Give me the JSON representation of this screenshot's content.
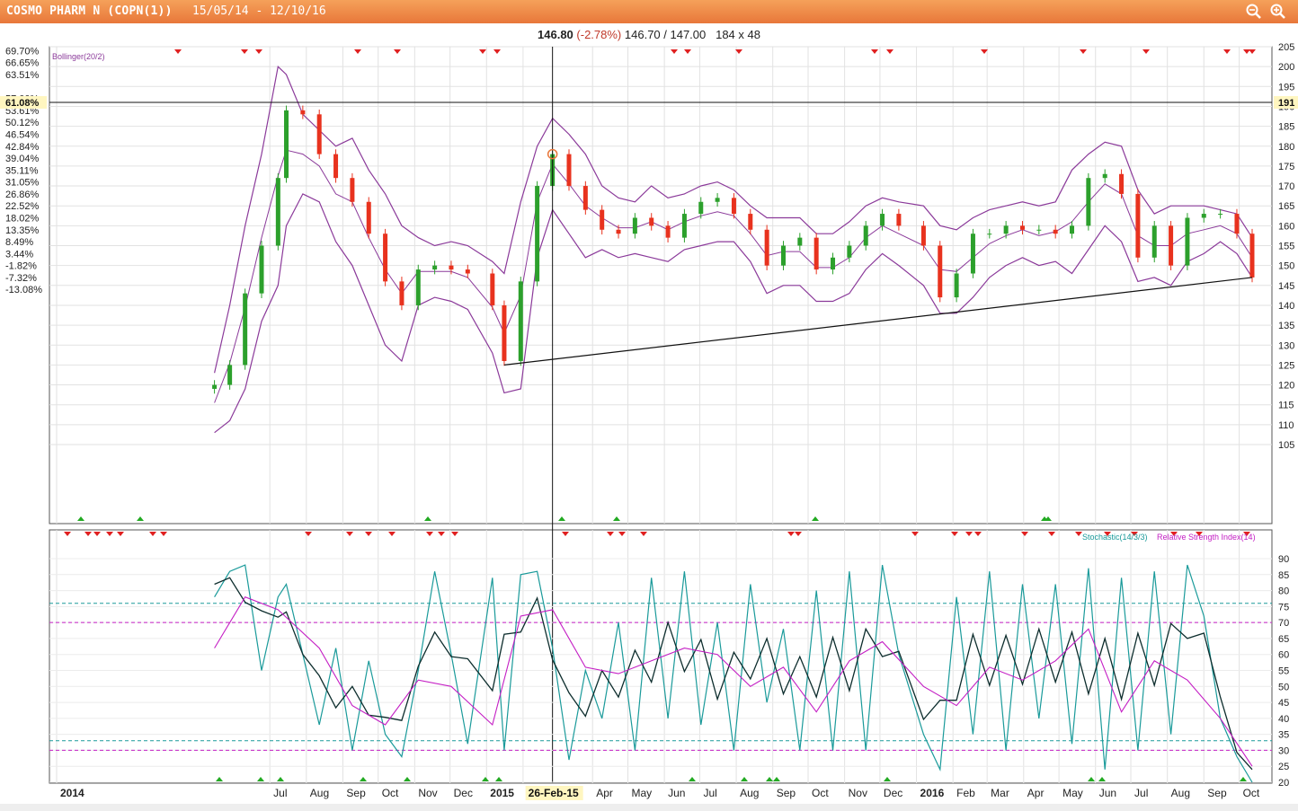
{
  "header": {
    "title": "COSMO PHARM N (COPN(1))",
    "date_range": "15/05/14 - 12/10/16",
    "zoom_in_icon": "zoom-in-icon",
    "zoom_out_icon": "zoom-out-icon"
  },
  "quote": {
    "last": "146.80",
    "change": "(-2.78%)",
    "bid_ask": "146.70 / 147.00",
    "size": "184 x 48"
  },
  "colors": {
    "title_bar": "#e8773a",
    "up_candle": "#2ca02c",
    "down_candle": "#e8321e",
    "bollinger": "#8b3a9a",
    "stochastic_k": "#1a9a9a",
    "stochastic_d": "#0d2d2d",
    "rsi": "#c41ec4",
    "sell_marker": "#e02020",
    "buy_marker": "#22aa22"
  },
  "chart_data": [
    {
      "type": "candlestick",
      "title": "",
      "legend": "Bollinger(20/2)",
      "y_right_ticks": [
        205,
        200,
        195,
        190,
        185,
        180,
        175,
        170,
        165,
        160,
        155,
        150,
        145,
        140,
        135,
        130,
        125,
        120,
        115,
        110,
        105
      ],
      "y_left_ticks": [
        "69.70%",
        "66.65%",
        "63.51%",
        "57.00%",
        "53.61%",
        "50.12%",
        "46.54%",
        "42.84%",
        "39.04%",
        "35.11%",
        "31.05%",
        "26.86%",
        "22.52%",
        "18.02%",
        "13.35%",
        "8.49%",
        "3.44%",
        "-1.82%",
        "-7.32%",
        "-13.08%"
      ],
      "crosshair": {
        "price": "191",
        "percent": "61.08%",
        "date": "26-Feb-15"
      },
      "trendline": {
        "from": [
          "2015-01-16",
          125
        ],
        "to": [
          "2016-10-12",
          147
        ]
      },
      "series": [
        {
          "name": "COPN(1)",
          "x": [
            "2014-05-15",
            "2014-05-28",
            "2014-06-10",
            "2014-06-24",
            "2014-07-08",
            "2014-07-15",
            "2014-07-29",
            "2014-08-12",
            "2014-08-26",
            "2014-09-09",
            "2014-09-23",
            "2014-10-07",
            "2014-10-21",
            "2014-11-04",
            "2014-11-18",
            "2014-12-02",
            "2014-12-16",
            "2015-01-06",
            "2015-01-16",
            "2015-01-30",
            "2015-02-13",
            "2015-02-26",
            "2015-03-12",
            "2015-03-26",
            "2015-04-09",
            "2015-04-23",
            "2015-05-07",
            "2015-05-21",
            "2015-06-04",
            "2015-06-18",
            "2015-07-02",
            "2015-07-16",
            "2015-07-30",
            "2015-08-13",
            "2015-08-27",
            "2015-09-10",
            "2015-09-24",
            "2015-10-08",
            "2015-10-22",
            "2015-11-05",
            "2015-11-19",
            "2015-12-03",
            "2015-12-17",
            "2016-01-07",
            "2016-01-21",
            "2016-02-04",
            "2016-02-18",
            "2016-03-03",
            "2016-03-17",
            "2016-03-31",
            "2016-04-14",
            "2016-04-28",
            "2016-05-12",
            "2016-05-26",
            "2016-06-09",
            "2016-06-23",
            "2016-07-07",
            "2016-07-21",
            "2016-08-04",
            "2016-08-18",
            "2016-09-01",
            "2016-09-15",
            "2016-09-29",
            "2016-10-12"
          ],
          "close": [
            120,
            125,
            143,
            155,
            172,
            189,
            188,
            178,
            172,
            166,
            158,
            146,
            140,
            149,
            150,
            149,
            148,
            140,
            126,
            146,
            170,
            178,
            170,
            164,
            159,
            158,
            162,
            160,
            157,
            163,
            166,
            167,
            163,
            159,
            150,
            155,
            157,
            149,
            152,
            155,
            160,
            163,
            160,
            155,
            142,
            148,
            158,
            158,
            160,
            159,
            159,
            158,
            160,
            172,
            173,
            168,
            152,
            160,
            150,
            162,
            163,
            163,
            158,
            147
          ]
        }
      ],
      "bollinger_upper": [
        123,
        140,
        160,
        178,
        200,
        198,
        188,
        184,
        180,
        182,
        174,
        168,
        160,
        157,
        155,
        156,
        155,
        151,
        148,
        166,
        180,
        187,
        183,
        178,
        170,
        167,
        166,
        170,
        167,
        168,
        170,
        171,
        169,
        165,
        162,
        162,
        162,
        158,
        158,
        161,
        165,
        167,
        166,
        165,
        160,
        159,
        162,
        164,
        165,
        166,
        165,
        166,
        174,
        178,
        181,
        180,
        169,
        163,
        165,
        165,
        165,
        164,
        163,
        157
      ],
      "bollinger_lower": [
        108,
        111,
        119,
        136,
        145,
        160,
        168,
        166,
        156,
        150,
        140,
        130,
        126,
        140,
        142,
        141,
        139,
        128,
        118,
        119,
        152,
        164,
        158,
        152,
        154,
        152,
        153,
        152,
        151,
        154,
        155,
        156,
        156,
        151,
        143,
        145,
        145,
        141,
        141,
        143,
        149,
        153,
        150,
        145,
        138,
        138,
        142,
        147,
        150,
        152,
        150,
        151,
        148,
        154,
        160,
        156,
        146,
        147,
        145,
        151,
        153,
        156,
        153,
        147
      ]
    },
    {
      "type": "line",
      "title": "",
      "legend": [
        "Stochastic(14/3/3)",
        "Relative Strength Index(14)"
      ],
      "y_right_ticks": [
        90,
        85,
        80,
        75,
        70,
        65,
        60,
        55,
        50,
        45,
        40,
        35,
        30,
        25,
        20
      ],
      "levels": {
        "stochastic": [
          76,
          33
        ],
        "rsi": [
          70,
          30
        ]
      },
      "x_labels": [
        "2014",
        "Jul",
        "Aug",
        "Sep",
        "Oct",
        "Nov",
        "Dec",
        "2015",
        "Feb",
        "26-Feb-15",
        "Apr",
        "May",
        "Jun",
        "Jul",
        "Aug",
        "Sep",
        "Oct",
        "Nov",
        "Dec",
        "2016",
        "Feb",
        "Mar",
        "Apr",
        "May",
        "Jun",
        "Jul",
        "Aug",
        "Sep",
        "Oct"
      ],
      "series": [
        {
          "name": "Stochastic(14/3/3)",
          "x": [
            "2014-05-15",
            "2014-05-28",
            "2014-06-10",
            "2014-06-24",
            "2014-07-08",
            "2014-07-15",
            "2014-07-29",
            "2014-08-12",
            "2014-08-26",
            "2014-09-09",
            "2014-09-23",
            "2014-10-07",
            "2014-10-21",
            "2014-11-04",
            "2014-11-18",
            "2014-12-02",
            "2014-12-16",
            "2015-01-06",
            "2015-01-16",
            "2015-01-30",
            "2015-02-13",
            "2015-02-26",
            "2015-03-12",
            "2015-03-26",
            "2015-04-09",
            "2015-04-23",
            "2015-05-07",
            "2015-05-21",
            "2015-06-04",
            "2015-06-18",
            "2015-07-02",
            "2015-07-16",
            "2015-07-30",
            "2015-08-13",
            "2015-08-27",
            "2015-09-10",
            "2015-09-24",
            "2015-10-08",
            "2015-10-22",
            "2015-11-05",
            "2015-11-19",
            "2015-12-03",
            "2015-12-17",
            "2016-01-07",
            "2016-01-21",
            "2016-02-04",
            "2016-02-18",
            "2016-03-03",
            "2016-03-17",
            "2016-03-31",
            "2016-04-14",
            "2016-04-28",
            "2016-05-12",
            "2016-05-26",
            "2016-06-09",
            "2016-06-23",
            "2016-07-07",
            "2016-07-21",
            "2016-08-04",
            "2016-08-18",
            "2016-09-01",
            "2016-09-15",
            "2016-09-29",
            "2016-10-12"
          ],
          "values": [
            78,
            86,
            88,
            55,
            78,
            82,
            60,
            38,
            62,
            30,
            58,
            35,
            28,
            55,
            86,
            60,
            32,
            84,
            30,
            85,
            86,
            62,
            27,
            55,
            40,
            70,
            30,
            84,
            40,
            86,
            38,
            70,
            30,
            82,
            45,
            68,
            30,
            80,
            30,
            86,
            30,
            88,
            60,
            35,
            24,
            78,
            35,
            86,
            30,
            82,
            40,
            82,
            32,
            87,
            24,
            84,
            30,
            86,
            35,
            88,
            72,
            40,
            28,
            20
          ]
        },
        {
          "name": "Relative Strength Index(14)",
          "x": [
            "2014-05-15",
            "2014-06-10",
            "2014-07-08",
            "2014-08-12",
            "2014-09-09",
            "2014-10-07",
            "2014-11-04",
            "2014-12-02",
            "2015-01-06",
            "2015-01-30",
            "2015-02-26",
            "2015-03-26",
            "2015-04-23",
            "2015-05-21",
            "2015-06-18",
            "2015-07-16",
            "2015-08-13",
            "2015-09-10",
            "2015-10-08",
            "2015-11-05",
            "2015-12-03",
            "2016-01-07",
            "2016-02-04",
            "2016-03-03",
            "2016-03-31",
            "2016-04-28",
            "2016-05-26",
            "2016-06-23",
            "2016-07-21",
            "2016-08-18",
            "2016-09-15",
            "2016-10-12"
          ],
          "values": [
            62,
            78,
            74,
            62,
            44,
            38,
            52,
            50,
            38,
            72,
            74,
            56,
            54,
            58,
            62,
            60,
            50,
            56,
            42,
            58,
            64,
            50,
            44,
            56,
            52,
            58,
            68,
            42,
            58,
            52,
            40,
            25
          ]
        }
      ]
    }
  ]
}
